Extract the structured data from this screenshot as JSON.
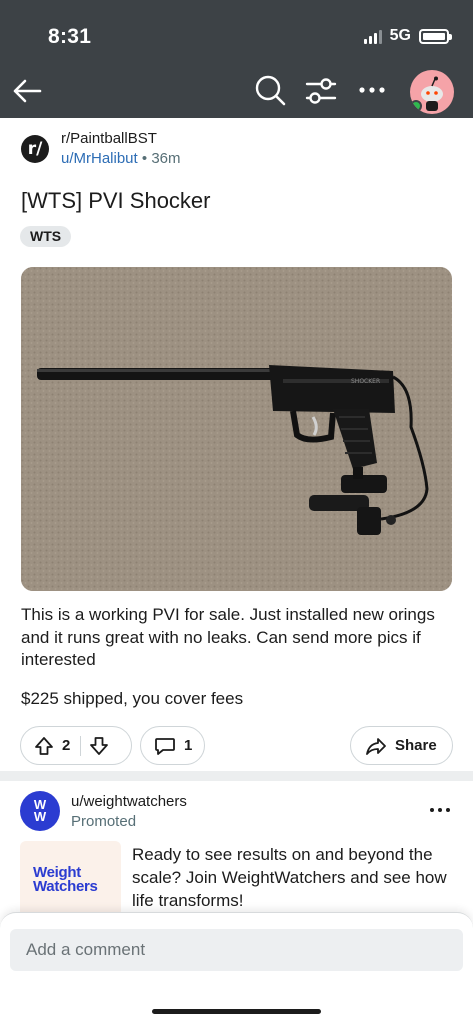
{
  "status_bar": {
    "time": "8:31",
    "network": "5G"
  },
  "post": {
    "subreddit": "r/PaintballBST",
    "subreddit_icon_letter": "r/",
    "author": "u/MrHalibut",
    "separator": "•",
    "age": "36m",
    "title": "[WTS] PVI Shocker",
    "flair": "WTS",
    "image_text": "SHOCKER",
    "body": "This is a working PVI for sale.  Just installed new orings and it runs great with no leaks.  Can send more pics if interested",
    "price_line": "$225 shipped, you cover fees",
    "upvotes": "2",
    "comments": "1",
    "share_label": "Share"
  },
  "ad": {
    "logo_line1": "W",
    "logo_line2": "W",
    "user": "u/weightwatchers",
    "promoted_label": "Promoted",
    "thumb_line1": "Weight",
    "thumb_line2": "Watchers",
    "text": "Ready to see results on and beyond the scale? Join WeightWatchers and see how life transforms!"
  },
  "comment_box": {
    "placeholder": "Add a comment"
  },
  "colors": {
    "top_bar": "#3d4246",
    "link_blue": "#2d6db5",
    "ww_blue": "#2b3cd1",
    "avatar_bg": "#f5a3a8",
    "online_green": "#2fb84f"
  },
  "icons": {
    "back": "arrow-left-icon",
    "search": "search-icon",
    "filter": "filter-icon",
    "more": "more-horizontal-icon",
    "upvote": "upvote-arrow-icon",
    "downvote": "downvote-arrow-icon",
    "comment": "comment-bubble-icon",
    "share": "share-arrow-icon"
  }
}
